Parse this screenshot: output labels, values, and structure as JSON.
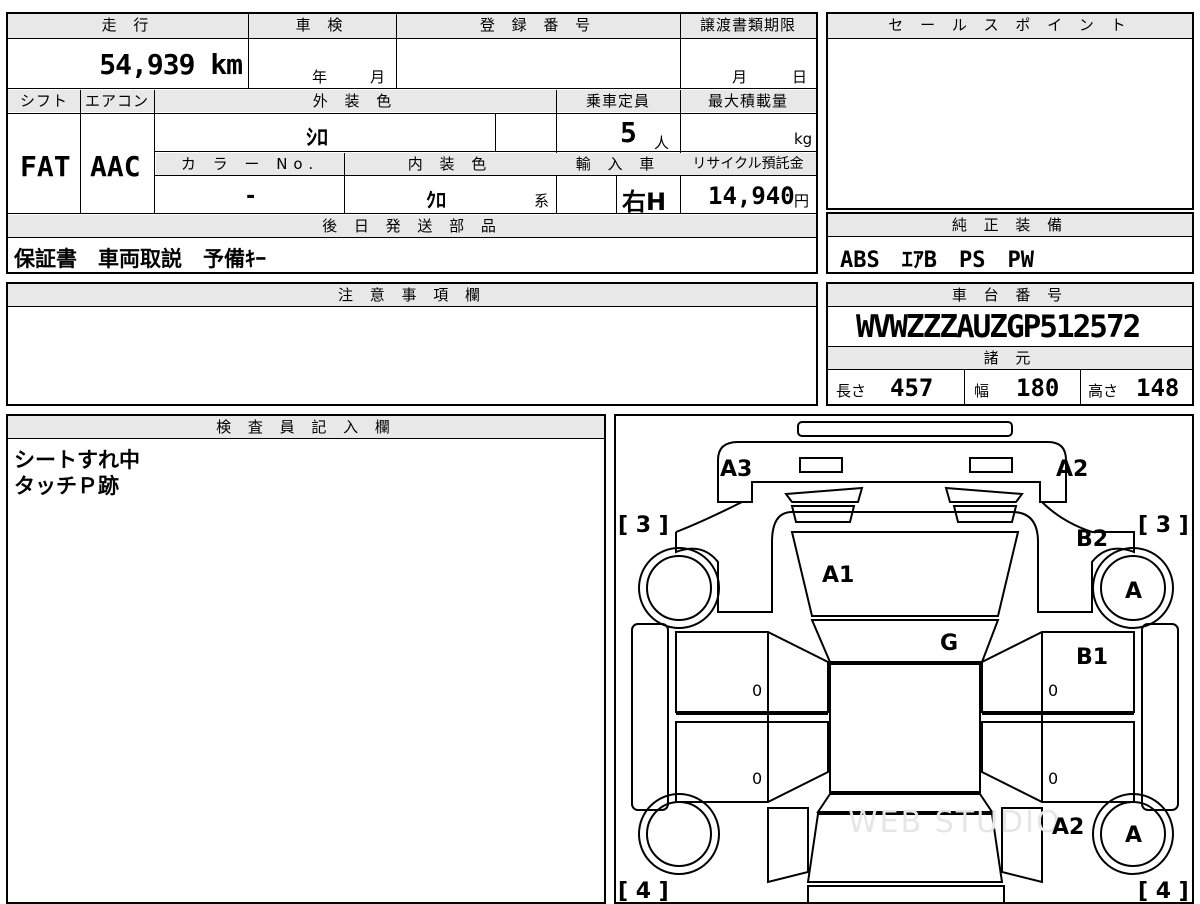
{
  "top_info": {
    "mileage_header": "走 行",
    "mileage_value": "54,939 km",
    "inspection_header": "車 検",
    "inspection_year": "年",
    "inspection_month": "月",
    "registration_header": "登 録 番 号",
    "transfer_header": "譲渡書類期限",
    "transfer_month": "月",
    "transfer_day": "日",
    "shift_header": "シフト",
    "shift_value": "FAT",
    "ac_header": "エアコン",
    "ac_value": "AAC",
    "exterior_header": "外 装 色",
    "exterior_value": "ｼﾛ",
    "capacity_header": "乗車定員",
    "capacity_value": "5",
    "capacity_unit": "人",
    "max_load_header": "最大積載量",
    "max_load_unit": "kg",
    "color_no_header": "カ ラ ー No.",
    "color_no_value": "-",
    "interior_header": "内 装 色",
    "interior_value": "ｸﾛ",
    "interior_suffix": "系",
    "import_header": "輸 入 車",
    "import_value": "右H",
    "recycle_header": "リサイクル預託金",
    "recycle_value": "14,940",
    "recycle_unit": "円",
    "later_parts_header": "後 日 発 送 部 品",
    "later_parts_value": "保証書　車両取説　予備ｷｰ"
  },
  "sales_point": {
    "header": "セ ー ル ス ポ イ ン ト",
    "content": ""
  },
  "genuine_equipment": {
    "header": "純 正 装 備",
    "value": "ABS　ｴｱB　PS　PW"
  },
  "notes": {
    "header": "注 意 事 項 欄",
    "content": ""
  },
  "chassis": {
    "header": "車 台 番 号",
    "value": "WVWZZZAUZGP512572",
    "spec_header": "諸 元",
    "length_label": "長さ",
    "length_value": "457",
    "width_label": "幅",
    "width_value": "180",
    "height_label": "高さ",
    "height_value": "148"
  },
  "inspector": {
    "header": "検 査 員 記 入 欄",
    "line1": "シートすれ中",
    "line2": "タッチＰ跡"
  },
  "diagram": {
    "marks": {
      "a3": "A3",
      "a2_top": "A2",
      "a1": "A1",
      "g": "G",
      "b2": "B2",
      "b1": "B1",
      "a_wheel_front": "A",
      "a_wheel_rear": "A",
      "a2_rear": "A2",
      "zero_1": "0",
      "zero_2": "0",
      "zero_3": "0",
      "zero_4": "0"
    },
    "brackets": {
      "front_left": "[ 3 ]",
      "front_right": "[ 3 ]",
      "rear_left": "[ 4 ]",
      "rear_right": "[ 4 ]"
    },
    "watermark": "WEB STUDIO"
  }
}
